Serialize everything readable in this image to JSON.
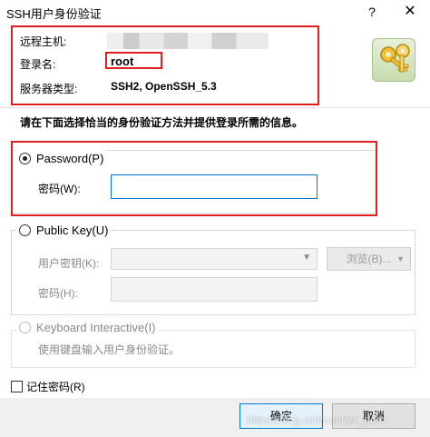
{
  "window": {
    "title": "SSH用户身份验证",
    "help_glyph": "?",
    "close_glyph": "✕"
  },
  "header": {
    "host_label": "远程主机:",
    "login_label": "登录名:",
    "login_value": "root",
    "server_type_label": "服务器类型:",
    "server_type_value": "SSH2, OpenSSH_5.3",
    "icon": "keys-icon"
  },
  "instruction": "请在下面选择恰当的身份验证方法并提供登录所需的信息。",
  "password_method": {
    "label": "Password(P)",
    "selected": true,
    "field_label": "密码(W):",
    "value": ""
  },
  "public_key_method": {
    "label": "Public Key(U)",
    "user_key_label": "用户密钥(K):",
    "passphrase_label": "密码(H):",
    "browse_label": "浏览(B)..."
  },
  "keyboard_method": {
    "label": "Keyboard Interactive(I)",
    "description": "使用键盘输入用户身份验证。"
  },
  "remember_label": "记住密码(R)",
  "buttons": {
    "ok": "确定",
    "cancel": "取消"
  },
  "watermark": "https://blog.csdn.net/yk_ddm",
  "colors": {
    "highlight_red": "#e02020",
    "focus_blue": "#0078d7"
  }
}
